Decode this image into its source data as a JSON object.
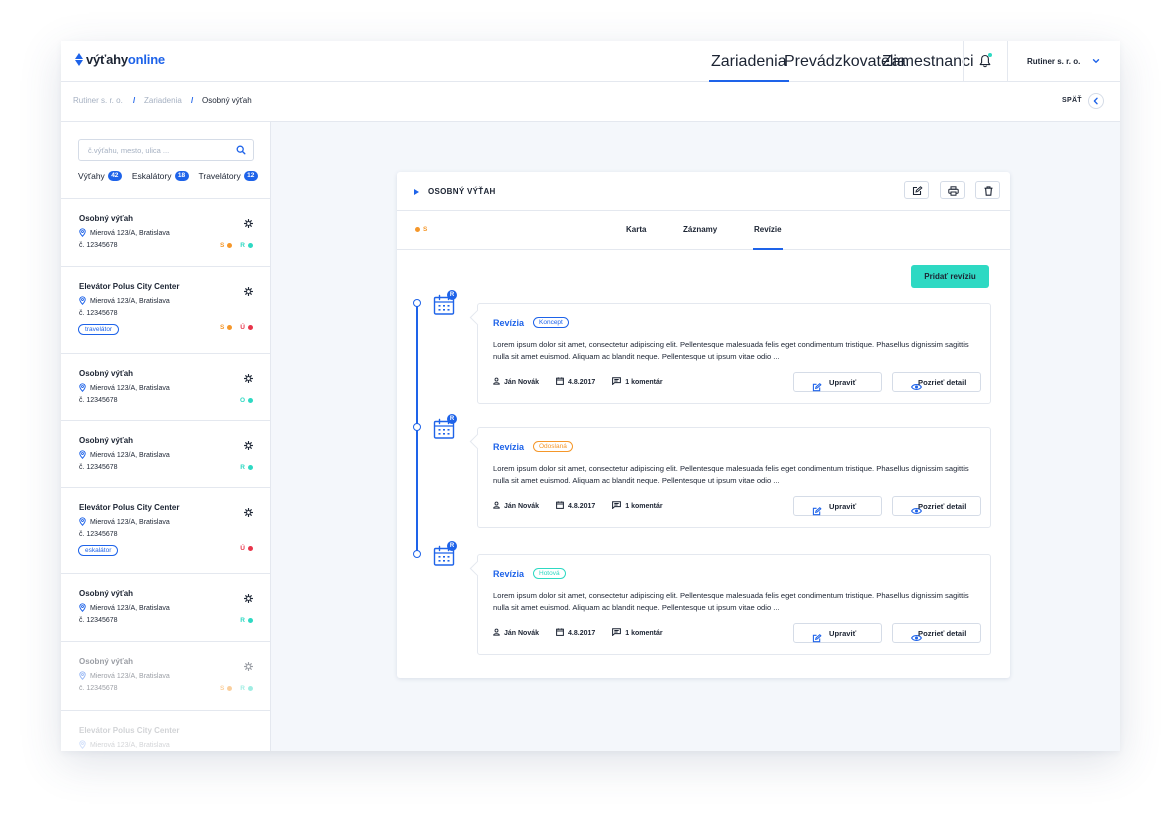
{
  "brand": {
    "part1": "výťahy",
    "part2": "online"
  },
  "nav": {
    "items": [
      {
        "label": "Zariadenia",
        "active": true
      },
      {
        "label": "Prevádzkovatelia"
      },
      {
        "label": "Zamestnanci"
      }
    ],
    "company": "Rutiner s. r. o."
  },
  "breadcrumb": {
    "items": [
      "Rutiner s. r. o.",
      "Zariadenia",
      "Osobný výťah"
    ],
    "separator": "/",
    "back_label": "SPÄŤ"
  },
  "sidebar": {
    "search_placeholder": "č.výťahu, mesto, ulica ...",
    "filters": [
      {
        "label": "Výťahy",
        "count": "42"
      },
      {
        "label": "Eskalátory",
        "count": "18"
      },
      {
        "label": "Travelátory",
        "count": "12"
      }
    ],
    "items": [
      {
        "title": "Osobný výťah",
        "address": "Mierová 123/A, Bratislava",
        "number": "č. 12345678",
        "status": [
          {
            "letter": "S",
            "color": "#f5972a"
          },
          {
            "letter": "R",
            "color": "#2ed9c3"
          }
        ]
      },
      {
        "title": "Elevátor Polus City Center",
        "address": "Mierová 123/A, Bratislava",
        "number": "č. 12345678",
        "tag": "travelátor",
        "status": [
          {
            "letter": "S",
            "color": "#f5972a"
          },
          {
            "letter": "Ú",
            "color": "#e8344a"
          }
        ]
      },
      {
        "title": "Osobný výťah",
        "address": "Mierová 123/A, Bratislava",
        "number": "č. 12345678",
        "status": [
          {
            "letter": "O",
            "color": "#2ed9c3"
          }
        ]
      },
      {
        "title": "Osobný výťah",
        "address": "Mierová 123/A, Bratislava",
        "number": "č. 12345678",
        "status": [
          {
            "letter": "R",
            "color": "#2ed9c3"
          }
        ]
      },
      {
        "title": "Elevátor Polus City Center",
        "address": "Mierová 123/A, Bratislava",
        "number": "č. 12345678",
        "tag": "eskalátor",
        "status": [
          {
            "letter": "Ú",
            "color": "#e8344a"
          }
        ]
      },
      {
        "title": "Osobný výťah",
        "address": "Mierová 123/A, Bratislava",
        "number": "č. 12345678",
        "status": [
          {
            "letter": "R",
            "color": "#2ed9c3"
          }
        ]
      },
      {
        "title": "Osobný výťah",
        "address": "Mierová 123/A, Bratislava",
        "number": "č. 12345678",
        "status": [
          {
            "letter": "S",
            "color": "#f5972a"
          },
          {
            "letter": "R",
            "color": "#2ed9c3"
          }
        ]
      },
      {
        "title": "Elevátor Polus City Center",
        "address": "Mierová 123/A, Bratislava"
      }
    ],
    "fab_label": "+"
  },
  "card": {
    "title": "OSOBNÝ VÝŤAH",
    "status_letter": "S",
    "tabs": [
      {
        "label": "Karta"
      },
      {
        "label": "Záznamy"
      },
      {
        "label": "Revízie",
        "active": true
      }
    ],
    "add_button": "Pridať revíziu",
    "revisions": [
      {
        "title": "Revízia",
        "tag": "Koncept",
        "tag_color": "#1e63e9",
        "calendar_badge": "R",
        "text": "Lorem ipsum dolor sit amet, consectetur adipiscing elit. Pellentesque malesuada felis eget condimentum tristique. Phasellus dignissim sagittis nulla sit amet euismod. Aliquam ac blandit neque. Pellentesque ut ipsum vitae odio ...",
        "author": "Ján Novák",
        "date": "4.8.2017",
        "comments": "1 komentár",
        "edit": "Upraviť",
        "detail": "Pozrieť detail"
      },
      {
        "title": "Revízia",
        "tag": "Odoslaná",
        "tag_color": "#f5972a",
        "calendar_badge": "R",
        "text": "Lorem ipsum dolor sit amet, consectetur adipiscing elit. Pellentesque malesuada felis eget condimentum tristique. Phasellus dignissim sagittis nulla sit amet euismod. Aliquam ac blandit neque. Pellentesque ut ipsum vitae odio ...",
        "author": "Ján Novák",
        "date": "4.8.2017",
        "comments": "1 komentár",
        "edit": "Upraviť",
        "detail": "Pozrieť detail"
      },
      {
        "title": "Revízia",
        "tag": "Hotová",
        "tag_color": "#2ed9c3",
        "calendar_badge": "R",
        "text": "Lorem ipsum dolor sit amet, consectetur adipiscing elit. Pellentesque malesuada felis eget condimentum tristique. Phasellus dignissim sagittis nulla sit amet euismod. Aliquam ac blandit neque. Pellentesque ut ipsum vitae odio ...",
        "author": "Ján Novák",
        "date": "4.8.2017",
        "comments": "1 komentár",
        "edit": "Upraviť",
        "detail": "Pozrieť detail"
      }
    ]
  },
  "colors": {
    "accent": "#1e63e9",
    "teal": "#2ed9c3",
    "orange": "#f5972a",
    "red": "#e8344a"
  },
  "icons": [
    "bell-icon",
    "chevron-down-icon",
    "chevron-left-icon",
    "search-icon",
    "gear-icon",
    "location-pin-icon",
    "edit-icon",
    "print-icon",
    "trash-icon",
    "calendar-icon",
    "user-icon",
    "comment-icon",
    "eye-icon",
    "plus-icon"
  ]
}
